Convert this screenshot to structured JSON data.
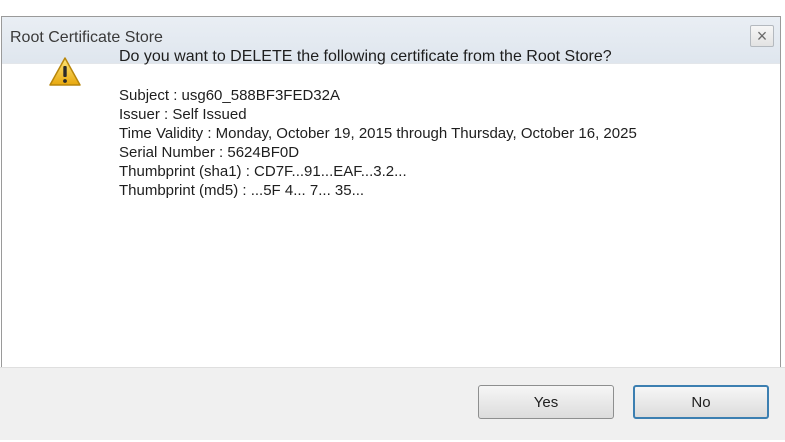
{
  "window": {
    "title": "Root Certificate Store",
    "close_label": "×"
  },
  "dialog": {
    "icon": "warning-icon",
    "question": "Do you want to DELETE the following certificate from the Root Store?",
    "details": {
      "subject": "Subject : usg60_588BF3FED32A",
      "issuer": "Issuer : Self Issued",
      "time_validity": "Time Validity : Monday, October 19, 2015 through Thursday, October 16, 2025",
      "serial_number": "Serial Number : 5624BF0D",
      "thumbprint_sha1": "Thumbprint (sha1) : CD7F...91...EAF...3.2...",
      "thumbprint_md5": "Thumbprint (md5) : ...5F 4... 7... 35..."
    }
  },
  "buttons": {
    "yes": "Yes",
    "no": "No"
  },
  "colors": {
    "titlebar": "#e3e9f0",
    "footer": "#f0f0f0",
    "focus_border": "#3c7fb1",
    "warning": "#f5c518"
  }
}
